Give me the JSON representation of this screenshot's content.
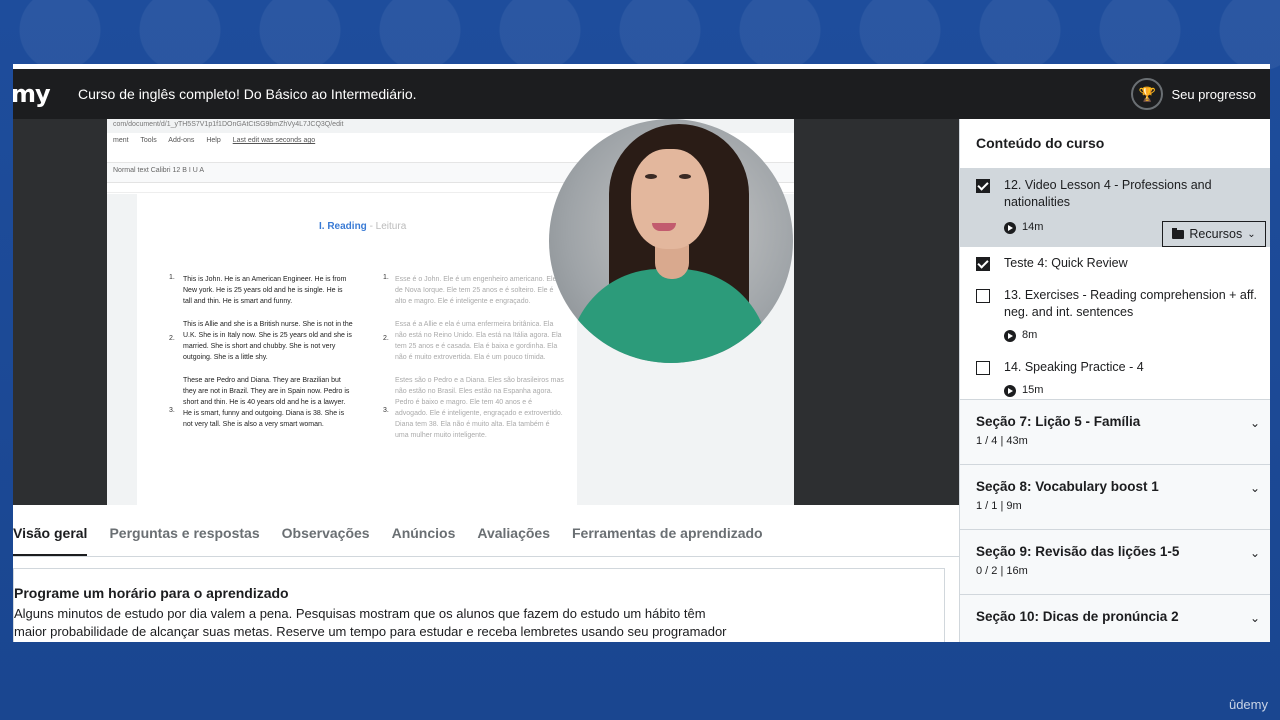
{
  "header": {
    "logo": "my",
    "course_title": "Curso de inglês completo! Do Básico ao Intermediário.",
    "progress_label": "Seu progresso"
  },
  "doc": {
    "url": "com/document/d/1_yTH5S7V1p1f1DOnGAtCtSG9bmZhVy4L7JCQ3Q/edit",
    "menu": [
      "ment",
      "Tools",
      "Add-ons",
      "Help",
      "Last edit was seconds ago"
    ],
    "toolbar": "Normal text   Calibri   12   B  I  U  A",
    "heading_main": "I. Reading",
    "heading_muted": " - Leitura",
    "left_items": [
      "This is John. He is an American Engineer. He is from New york. He is 25 years old and he is single. He is tall and thin. He is smart and funny.",
      "This is Allie and she is a British nurse. She is not in the U.K. She is in Italy now. She is 25 years old and she is married. She is short and chubby. She is not very outgoing. She is a little shy.",
      "These are Pedro and Diana. They are Brazilian but they are not in Brazil. They are in Spain now. Pedro is short and thin. He is 40 years old and he is a lawyer. He is smart, funny and outgoing. Diana is 38. She is not very tall. She is also a very smart woman."
    ],
    "right_items": [
      "Esse é o John. Ele é um engenheiro americano. Ele é de Nova Iorque. Ele tem 25 anos e é solteiro. Ele é alto e magro. Ele é inteligente e engraçado.",
      "Essa é a Allie e ela é uma enfermeira britânica. Ela não está no Reino Unido. Ela está na Itália agora. Ela tem 25 anos e é casada. Ela é baixa e gordinha. Ela não é muito extrovertida. Ela é um pouco tímida.",
      "Estes são o Pedro e a Diana. Eles são brasileiros mas não estão no Brasil. Eles estão na Espanha agora. Pedro é baixo e magro. Ele tem 40 anos e é advogado. Ele é inteligente, engraçado e extrovertido. Diana tem 38. Ela não é muito alta. Ela também é uma mulher muito inteligente."
    ],
    "numbers": [
      "1.",
      "2.",
      "3."
    ]
  },
  "tabs": [
    {
      "label": "Visão geral"
    },
    {
      "label": "Perguntas e respostas"
    },
    {
      "label": "Observações"
    },
    {
      "label": "Anúncios"
    },
    {
      "label": "Avaliações"
    },
    {
      "label": "Ferramentas de aprendizado"
    }
  ],
  "panel": {
    "title": "Programe um horário para o aprendizado",
    "text": "Alguns minutos de estudo por dia valem a pena. Pesquisas mostram que os alunos que fazem do estudo um hábito têm maior probabilidade de alcançar suas metas. Reserve um tempo para estudar e receba lembretes usando seu programador de aprendizado."
  },
  "sidebar": {
    "heading": "Conteúdo do curso",
    "lessons": [
      {
        "title": "12. Video Lesson 4 - Professions and nationalities",
        "duration": "14m",
        "checked": true,
        "current": true,
        "resources": "Recursos"
      },
      {
        "title": "Teste 4: Quick Review",
        "duration": "",
        "checked": true,
        "current": false
      },
      {
        "title": "13. Exercises - Reading comprehension + aff. neg. and int. sentences",
        "duration": "8m",
        "checked": false,
        "current": false
      },
      {
        "title": "14. Speaking Practice - 4",
        "duration": "15m",
        "checked": false,
        "current": false
      }
    ],
    "sections": [
      {
        "title": "Seção 7: Lição 5 - Família",
        "sub": "1 / 4 | 43m"
      },
      {
        "title": "Seção 8: Vocabulary boost 1",
        "sub": "1 / 1 | 9m"
      },
      {
        "title": "Seção 9: Revisão das lições 1-5",
        "sub": "0 / 2 | 16m"
      },
      {
        "title": "Seção 10: Dicas de pronúncia 2",
        "sub": ""
      }
    ]
  },
  "watermark": "ûdemy"
}
